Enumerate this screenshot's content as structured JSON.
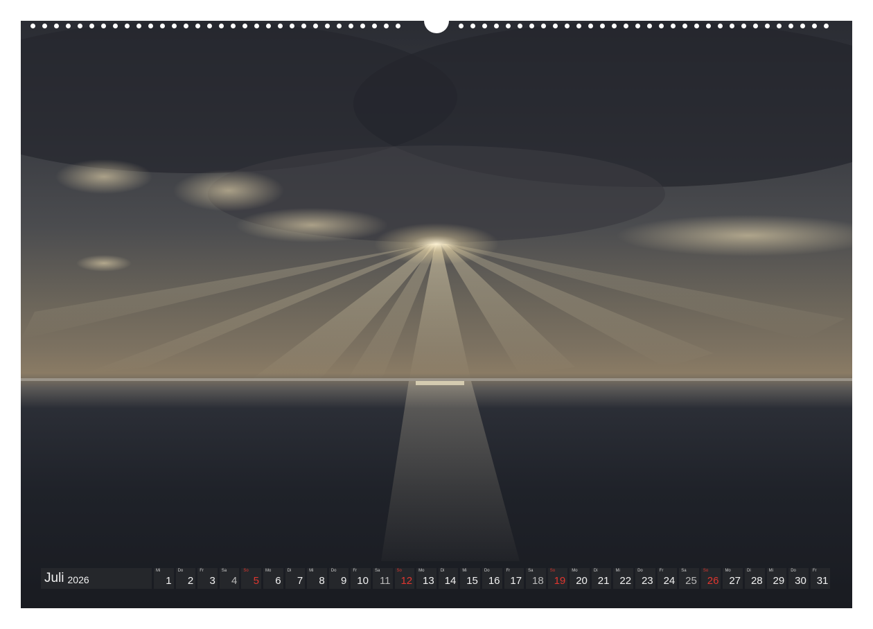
{
  "calendar": {
    "month": "Juli",
    "year": "2026",
    "days": [
      {
        "n": "1",
        "wd": "Mi"
      },
      {
        "n": "2",
        "wd": "Do"
      },
      {
        "n": "3",
        "wd": "Fr"
      },
      {
        "n": "4",
        "wd": "Sa"
      },
      {
        "n": "5",
        "wd": "So"
      },
      {
        "n": "6",
        "wd": "Mo"
      },
      {
        "n": "7",
        "wd": "Di"
      },
      {
        "n": "8",
        "wd": "Mi"
      },
      {
        "n": "9",
        "wd": "Do"
      },
      {
        "n": "10",
        "wd": "Fr"
      },
      {
        "n": "11",
        "wd": "Sa"
      },
      {
        "n": "12",
        "wd": "So"
      },
      {
        "n": "13",
        "wd": "Mo"
      },
      {
        "n": "14",
        "wd": "Di"
      },
      {
        "n": "15",
        "wd": "Mi"
      },
      {
        "n": "16",
        "wd": "Do"
      },
      {
        "n": "17",
        "wd": "Fr"
      },
      {
        "n": "18",
        "wd": "Sa"
      },
      {
        "n": "19",
        "wd": "So"
      },
      {
        "n": "20",
        "wd": "Mo"
      },
      {
        "n": "21",
        "wd": "Di"
      },
      {
        "n": "22",
        "wd": "Mi"
      },
      {
        "n": "23",
        "wd": "Do"
      },
      {
        "n": "24",
        "wd": "Fr"
      },
      {
        "n": "25",
        "wd": "Sa"
      },
      {
        "n": "26",
        "wd": "So"
      },
      {
        "n": "27",
        "wd": "Mo"
      },
      {
        "n": "28",
        "wd": "Di"
      },
      {
        "n": "29",
        "wd": "Mi"
      },
      {
        "n": "30",
        "wd": "Do"
      },
      {
        "n": "31",
        "wd": "Fr"
      }
    ]
  },
  "colors": {
    "sunday": "#e0362f",
    "strip": "#26282c"
  }
}
